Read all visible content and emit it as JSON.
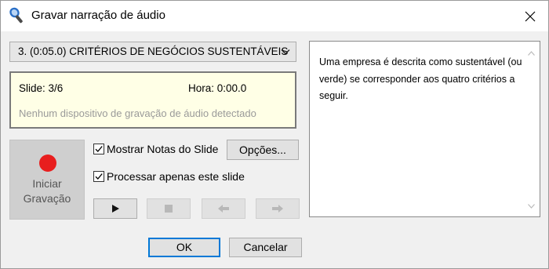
{
  "window": {
    "title": "Gravar narração de áudio",
    "title_icon": "microphone-icon",
    "close_icon": "close-icon"
  },
  "slide_select": {
    "selected": "3. (0:05.0) CRITÉRIOS DE NEGÓCIOS SUSTENTÁVEIS",
    "icon": "chevron-down-icon"
  },
  "info": {
    "slide": "Slide: 3/6",
    "hora": "Hora: 0:00.0",
    "status": "Nenhum dispositivo de gravação de áudio detectado"
  },
  "record": {
    "line1": "Iniciar",
    "line2": "Gravação",
    "color": "#e81e1e"
  },
  "options": {
    "show_notes_label": "Mostrar Notas do Slide",
    "show_notes_checked": true,
    "process_only_label": "Processar apenas este slide",
    "process_only_checked": true,
    "opcoes_label": "Opções..."
  },
  "controls": [
    "play-icon",
    "stop-icon",
    "previous-icon",
    "next-icon"
  ],
  "notes": {
    "text": "Uma empresa é descrita como sustentável (ou verde) se corresponder aos quatro critérios a seguir."
  },
  "footer": {
    "ok_label": "OK",
    "cancel_label": "Cancelar",
    "accent": "#0078d7"
  }
}
